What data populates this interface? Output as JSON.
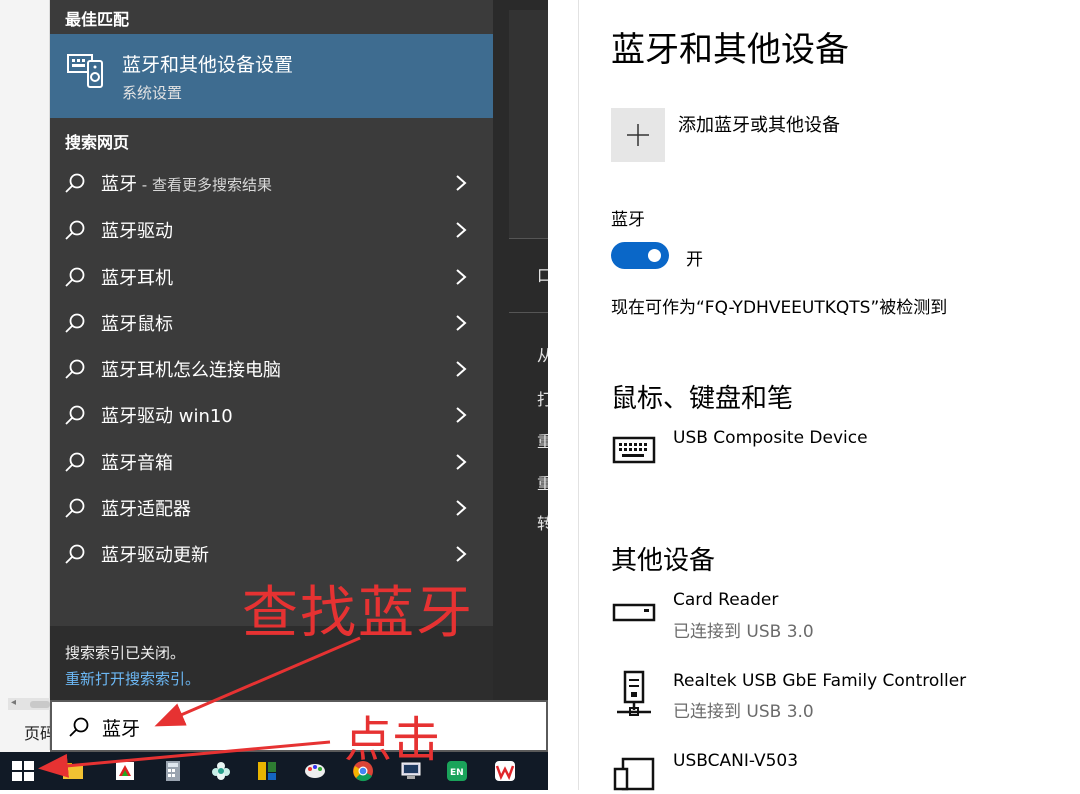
{
  "taskbar_page_fragment": "页码",
  "search_panel": {
    "best_match_header": "最佳匹配",
    "best_match": {
      "title": "蓝牙和其他设备设置",
      "subtitle": "系统设置"
    },
    "web_header": "搜索网页",
    "results": [
      {
        "text": "蓝牙",
        "hint": " - 查看更多搜索结果"
      },
      {
        "text": "蓝牙驱动",
        "hint": ""
      },
      {
        "text": "蓝牙耳机",
        "hint": ""
      },
      {
        "text": "蓝牙鼠标",
        "hint": ""
      },
      {
        "text": "蓝牙耳机怎么连接电脑",
        "hint": ""
      },
      {
        "text": "蓝牙驱动 win10",
        "hint": ""
      },
      {
        "text": "蓝牙音箱",
        "hint": ""
      },
      {
        "text": "蓝牙适配器",
        "hint": ""
      },
      {
        "text": "蓝牙驱动更新",
        "hint": ""
      }
    ],
    "index_off": "搜索索引已关闭。",
    "index_link": "重新打开搜索索引。",
    "right_fragments": [
      "口",
      "从",
      "打",
      "重",
      "重",
      "转"
    ],
    "search_query": "蓝牙"
  },
  "annotations": {
    "find": "查找蓝牙",
    "click": "点击",
    "color": "#e63232"
  },
  "taskbar_icons": [
    "windows-start-icon",
    "folder-icon",
    "game-icon",
    "calculator-icon",
    "flower-icon",
    "app-icon",
    "paint-icon",
    "chrome-icon",
    "computer-icon",
    "en-app-icon",
    "wps-icon"
  ],
  "settings": {
    "title": "蓝牙和其他设备",
    "add_device": "添加蓝牙或其他设备",
    "bluetooth_label": "蓝牙",
    "bluetooth_state": "开",
    "bluetooth_on": true,
    "discoverable": "现在可作为“FQ-YDHVEEUTKQTS”被检测到",
    "mouse_category": "鼠标、键盘和笔",
    "mouse_devices": [
      {
        "name": "USB Composite Device",
        "icon": "keyboard-icon"
      }
    ],
    "other_category": "其他设备",
    "other_devices": [
      {
        "name": "Card Reader",
        "status": "已连接到 USB 3.0",
        "icon": "card-reader-icon"
      },
      {
        "name": "Realtek USB GbE Family Controller",
        "status": "已连接到 USB 3.0",
        "icon": "network-adapter-icon"
      },
      {
        "name": "USBCANI-V503",
        "status": "",
        "icon": "device-icon"
      }
    ],
    "accent": "#0a67c8"
  }
}
